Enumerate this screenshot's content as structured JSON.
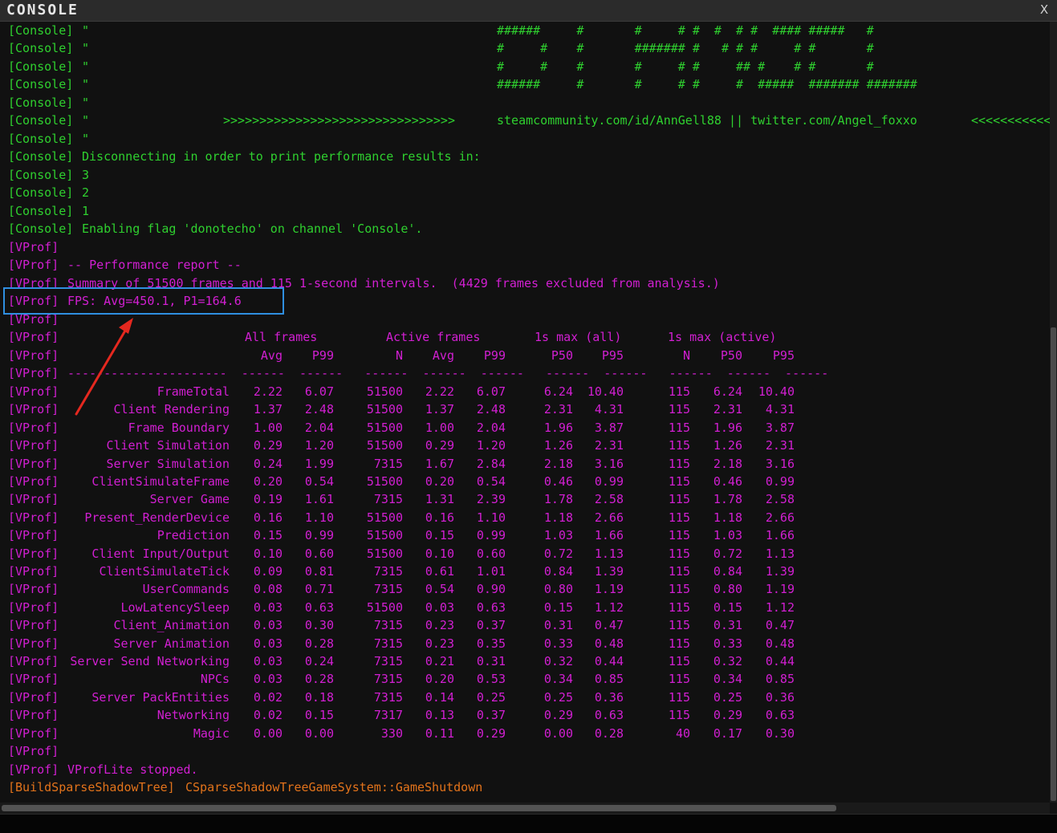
{
  "window": {
    "title": "CONSOLE",
    "close_label": "X"
  },
  "tags": {
    "console": "[Console]",
    "vprof": "[VProf]",
    "build": "[BuildSparseShadowTree]"
  },
  "banner": {
    "quote": "\"",
    "rows": [
      "######     #       #     # #  #  # #  #### #####   #",
      "#     #    #       ####### #   # # #     # #       #",
      "#     #    #       #     # #     ## #    # #       #",
      "######     #       #     # #     #  #####  ####### #######"
    ],
    "link_left": ">>>>>>>>>>>>>>>>>>>>>>>>>>>>>>>>",
    "link_mid": "steamcommunity.com/id/AnnGell88 || twitter.com/Angel_foxxo",
    "link_right": "<<<<<<<<<<<<<"
  },
  "messages": {
    "disconnecting": "Disconnecting in order to print performance results in:",
    "count3": "3",
    "count2": "2",
    "count1": "1",
    "flag": "Enabling flag 'donotecho' on channel 'Console'.",
    "perf_report": "-- Performance report --",
    "summary": "Summary of 51500 frames and 115 1-second intervals.  (4429 frames excluded from analysis.)",
    "fps": "FPS: Avg=450.1, P1=164.6",
    "stopped": "VProfLite stopped.",
    "shutdown": "CSparseShadowTreeGameSystem::GameShutdown"
  },
  "table": {
    "groups": [
      "All frames",
      "Active frames",
      "1s max (all)",
      "1s max (active)"
    ],
    "headers": [
      "Avg",
      "P99",
      "N",
      "Avg",
      "P99",
      "P50",
      "P95",
      "N",
      "P50",
      "P95"
    ],
    "rows": [
      [
        "FrameTotal",
        "2.22",
        "6.07",
        "51500",
        "2.22",
        "6.07",
        "6.24",
        "10.40",
        "115",
        "6.24",
        "10.40"
      ],
      [
        "Client Rendering",
        "1.37",
        "2.48",
        "51500",
        "1.37",
        "2.48",
        "2.31",
        "4.31",
        "115",
        "2.31",
        "4.31"
      ],
      [
        "Frame Boundary",
        "1.00",
        "2.04",
        "51500",
        "1.00",
        "2.04",
        "1.96",
        "3.87",
        "115",
        "1.96",
        "3.87"
      ],
      [
        "Client Simulation",
        "0.29",
        "1.20",
        "51500",
        "0.29",
        "1.20",
        "1.26",
        "2.31",
        "115",
        "1.26",
        "2.31"
      ],
      [
        "Server Simulation",
        "0.24",
        "1.99",
        "7315",
        "1.67",
        "2.84",
        "2.18",
        "3.16",
        "115",
        "2.18",
        "3.16"
      ],
      [
        "ClientSimulateFrame",
        "0.20",
        "0.54",
        "51500",
        "0.20",
        "0.54",
        "0.46",
        "0.99",
        "115",
        "0.46",
        "0.99"
      ],
      [
        "Server Game",
        "0.19",
        "1.61",
        "7315",
        "1.31",
        "2.39",
        "1.78",
        "2.58",
        "115",
        "1.78",
        "2.58"
      ],
      [
        "Present_RenderDevice",
        "0.16",
        "1.10",
        "51500",
        "0.16",
        "1.10",
        "1.18",
        "2.66",
        "115",
        "1.18",
        "2.66"
      ],
      [
        "Prediction",
        "0.15",
        "0.99",
        "51500",
        "0.15",
        "0.99",
        "1.03",
        "1.66",
        "115",
        "1.03",
        "1.66"
      ],
      [
        "Client Input/Output",
        "0.10",
        "0.60",
        "51500",
        "0.10",
        "0.60",
        "0.72",
        "1.13",
        "115",
        "0.72",
        "1.13"
      ],
      [
        "ClientSimulateTick",
        "0.09",
        "0.81",
        "7315",
        "0.61",
        "1.01",
        "0.84",
        "1.39",
        "115",
        "0.84",
        "1.39"
      ],
      [
        "UserCommands",
        "0.08",
        "0.71",
        "7315",
        "0.54",
        "0.90",
        "0.80",
        "1.19",
        "115",
        "0.80",
        "1.19"
      ],
      [
        "LowLatencySleep",
        "0.03",
        "0.63",
        "51500",
        "0.03",
        "0.63",
        "0.15",
        "1.12",
        "115",
        "0.15",
        "1.12"
      ],
      [
        "Client_Animation",
        "0.03",
        "0.30",
        "7315",
        "0.23",
        "0.37",
        "0.31",
        "0.47",
        "115",
        "0.31",
        "0.47"
      ],
      [
        "Server Animation",
        "0.03",
        "0.28",
        "7315",
        "0.23",
        "0.35",
        "0.33",
        "0.48",
        "115",
        "0.33",
        "0.48"
      ],
      [
        "Server Send Networking",
        "0.03",
        "0.24",
        "7315",
        "0.21",
        "0.31",
        "0.32",
        "0.44",
        "115",
        "0.32",
        "0.44"
      ],
      [
        "NPCs",
        "0.03",
        "0.28",
        "7315",
        "0.20",
        "0.53",
        "0.34",
        "0.85",
        "115",
        "0.34",
        "0.85"
      ],
      [
        "Server PackEntities",
        "0.02",
        "0.18",
        "7315",
        "0.14",
        "0.25",
        "0.25",
        "0.36",
        "115",
        "0.25",
        "0.36"
      ],
      [
        "Networking",
        "0.02",
        "0.15",
        "7317",
        "0.13",
        "0.37",
        "0.29",
        "0.63",
        "115",
        "0.29",
        "0.63"
      ],
      [
        "Magic",
        "0.00",
        "0.00",
        "330",
        "0.11",
        "0.29",
        "0.00",
        "0.28",
        "40",
        "0.17",
        "0.30"
      ]
    ]
  },
  "colors": {
    "console_tag": "#2fd02f",
    "vprof_tag": "#d21fd2",
    "build_tag": "#e2731b",
    "highlight": "#2f8fe0",
    "arrow": "#e5281f"
  }
}
